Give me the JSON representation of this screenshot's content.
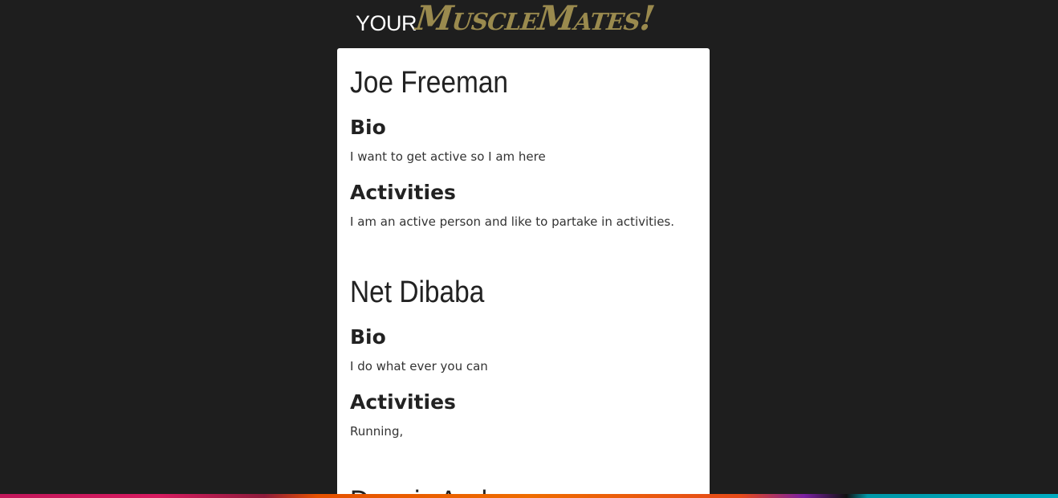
{
  "header": {
    "prefix": "YOUR",
    "brand": "MuscleMates!"
  },
  "profiles": [
    {
      "name": "Joe Freeman",
      "bio_heading": "Bio",
      "bio": "I want to get active so I am here",
      "activities_heading": "Activities",
      "activities": "I am an active person and like to partake in activities."
    },
    {
      "name": "Net Dibaba",
      "bio_heading": "Bio",
      "bio": "I do what ever you can",
      "activities_heading": "Activities",
      "activities": "Running,"
    },
    {
      "name": "Dennis Andrews"
    }
  ]
}
